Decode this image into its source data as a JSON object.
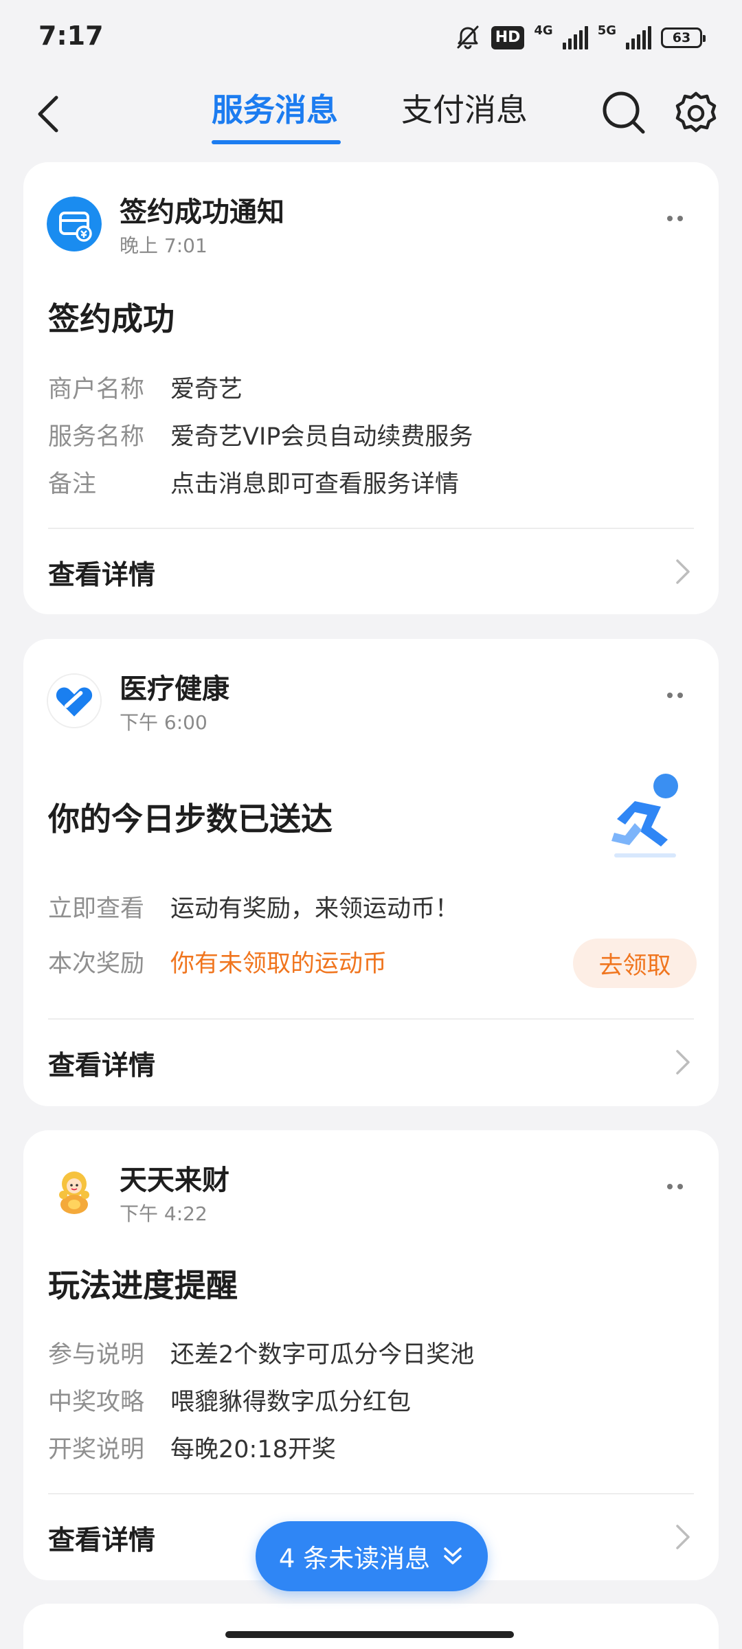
{
  "status_bar": {
    "time": "7:17",
    "hd_label": "HD",
    "net_4g": "4G",
    "net_5g": "5G",
    "battery": "63"
  },
  "nav": {
    "tabs": [
      {
        "label": "服务消息",
        "active": true
      },
      {
        "label": "支付消息",
        "active": false
      }
    ],
    "accent_color": "#1c7cf0"
  },
  "cards": [
    {
      "source": "签约成功通知",
      "time": "晚上 7:01",
      "title": "签约成功",
      "rows": [
        {
          "label": "商户名称",
          "value": "爱奇艺"
        },
        {
          "label": "服务名称",
          "value": "爱奇艺VIP会员自动续费服务"
        },
        {
          "label": "备注",
          "value": "点击消息即可查看服务详情"
        }
      ],
      "details": "查看详情",
      "icon": "contract-icon"
    },
    {
      "source": "医疗健康",
      "time": "下午 6:00",
      "title": "你的今日步数已送达",
      "rows": [
        {
          "label": "立即查看",
          "value": "运动有奖励，来领运动币！"
        },
        {
          "label": "本次奖励",
          "value": "你有未领取的运动币"
        }
      ],
      "claim_label": "去领取",
      "details": "查看详情",
      "icon": "health-heart-icon"
    },
    {
      "source": "天天来财",
      "time": "下午 4:22",
      "title": "玩法进度提醒",
      "rows": [
        {
          "label": "参与说明",
          "value": "还差2个数字可瓜分今日奖池"
        },
        {
          "label": "中奖攻略",
          "value": "喂貔貅得数字瓜分红包"
        },
        {
          "label": "开奖说明",
          "value": "每晚20:18开奖"
        }
      ],
      "details": "查看详情",
      "icon": "fortune-mascot-icon"
    }
  ],
  "unread": {
    "label": "4 条未读消息"
  },
  "colors": {
    "orange": "#f0751e",
    "pill": "#2f86f5"
  }
}
